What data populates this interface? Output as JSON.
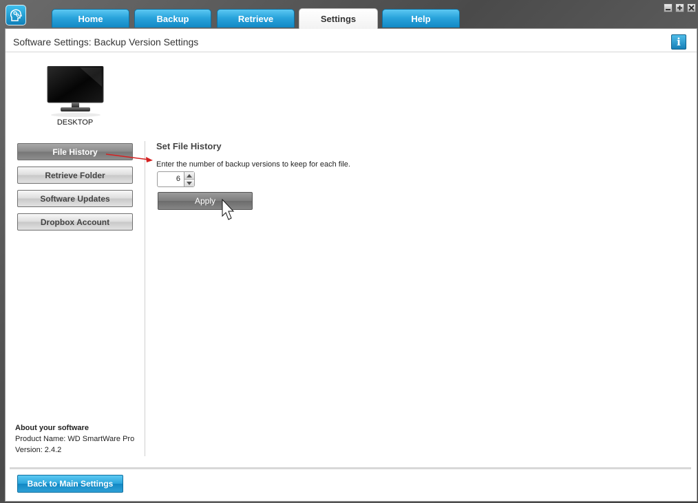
{
  "titlebar": {
    "logo_icon": "gears-head-icon",
    "window_controls": [
      "minimize",
      "maximize",
      "close"
    ]
  },
  "tabs": [
    {
      "label": "Home",
      "active": false
    },
    {
      "label": "Backup",
      "active": false
    },
    {
      "label": "Retrieve",
      "active": false
    },
    {
      "label": "Settings",
      "active": true
    },
    {
      "label": "Help",
      "active": false
    }
  ],
  "header": {
    "title": "Software Settings: Backup Version Settings",
    "info_icon_glyph": "i"
  },
  "device": {
    "label": "DESKTOP",
    "icon": "monitor-icon"
  },
  "sidebar": {
    "items": [
      {
        "label": "File History",
        "active": true
      },
      {
        "label": "Retrieve Folder",
        "active": false
      },
      {
        "label": "Software Updates",
        "active": false
      },
      {
        "label": "Dropbox Account",
        "active": false
      }
    ]
  },
  "main": {
    "section_title": "Set File History",
    "instruction": "Enter the number of backup versions to keep for each file.",
    "versions_value": "6",
    "apply_label": "Apply"
  },
  "about": {
    "title": "About your software",
    "product": "Product Name: WD SmartWare Pro",
    "version": "Version: 2.4.2"
  },
  "footer": {
    "back_label": "Back to Main Settings"
  },
  "colors": {
    "accent_blue": "#2aa4dc",
    "annotation_red": "#d42020",
    "active_button_gray": "#7d7d7d"
  }
}
